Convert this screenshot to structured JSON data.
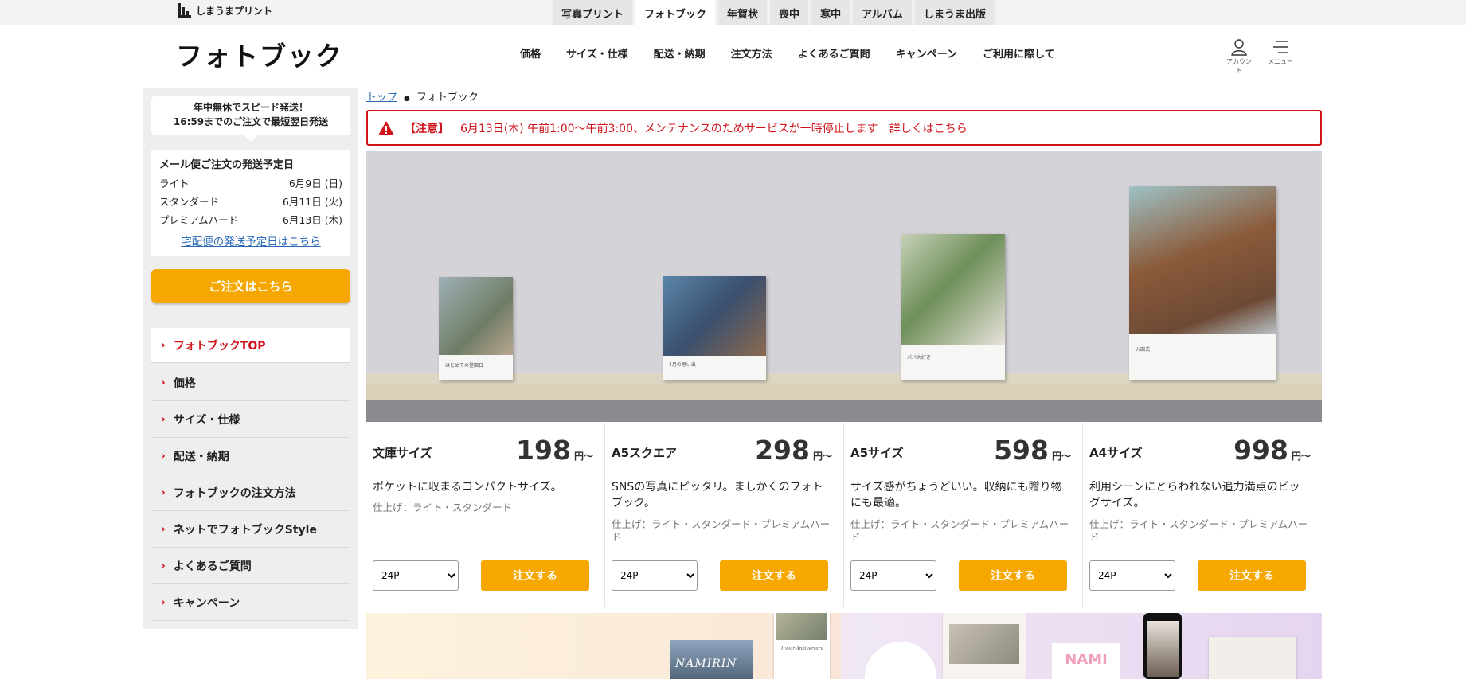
{
  "brand": {
    "logo_text": "しまうまプリント"
  },
  "top_tabs": [
    "写真プリント",
    "フォトブック",
    "年賀状",
    "喪中",
    "寒中",
    "アルバム",
    "しまうま出版"
  ],
  "header": {
    "title": "フォトブック",
    "nav": [
      "価格",
      "サイズ・仕様",
      "配送・納期",
      "注文方法",
      "よくあるご質問",
      "キャンペーン",
      "ご利用に際して"
    ],
    "account_label": "アカウント",
    "menu_label": "メニュー"
  },
  "sidebar": {
    "bubble_line1": "年中無休でスピード発送！",
    "bubble_line2": "16:59までのご注文で最短翌日発送",
    "ship_title": "メール便ご注文の発送予定日",
    "ship_rows": [
      {
        "label": "ライト",
        "date": "6月9日 (日)"
      },
      {
        "label": "スタンダード",
        "date": "6月11日 (火)"
      },
      {
        "label": "プレミアムハード",
        "date": "6月13日 (木)"
      }
    ],
    "ship_link": "宅配便の発送予定日はこちら",
    "order_button": "ご注文はこちら",
    "nav": [
      "フォトブックTOP",
      "価格",
      "サイズ・仕様",
      "配送・納期",
      "フォトブックの注文方法",
      "ネットでフォトブックStyle",
      "よくあるご質問",
      "キャンペーン"
    ]
  },
  "breadcrumb": {
    "home": "トップ",
    "current": "フォトブック"
  },
  "notice": {
    "label": "【注意】",
    "text": "6月13日(木) 午前1:00〜午前3:00、メンテナンスのためサービスが一時停止します　詳しくはこちら"
  },
  "hero_books": [
    {
      "caption": "はじめての登園日"
    },
    {
      "caption": "4月の思い出"
    },
    {
      "caption": "パパ大好き"
    },
    {
      "caption": "入園式"
    }
  ],
  "products": [
    {
      "name": "文庫サイズ",
      "price": "198",
      "unit": "円～",
      "desc": "ポケットに収まるコンパクトサイズ。",
      "finish": "仕上げ：ライト・スタンダード",
      "pages": "24P",
      "button": "注文する"
    },
    {
      "name": "A5スクエア",
      "price": "298",
      "unit": "円～",
      "desc": "SNSの写真にピッタリ。ましかくのフォトブック。",
      "finish": "仕上げ：ライト・スタンダード・プレミアムハード",
      "pages": "24P",
      "button": "注文する"
    },
    {
      "name": "A5サイズ",
      "price": "598",
      "unit": "円～",
      "desc": "サイズ感がちょうどいい。収納にも贈り物にも最適。",
      "finish": "仕上げ：ライト・スタンダード・プレミアムハード",
      "pages": "24P",
      "button": "注文する"
    },
    {
      "name": "A4サイズ",
      "price": "998",
      "unit": "円～",
      "desc": "利用シーンにとらわれない追力満点のビッグサイズ。",
      "finish": "仕上げ：ライト・スタンダード・プレミアムハード",
      "pages": "24P",
      "button": "注文する"
    }
  ],
  "banner": {
    "text1": "NAMIRIN",
    "text2": "1 year Anniversary",
    "text3": "NAMI"
  },
  "colors": {
    "accent": "#f7a800",
    "alert": "#d0121b",
    "link": "#2a6ab7"
  }
}
